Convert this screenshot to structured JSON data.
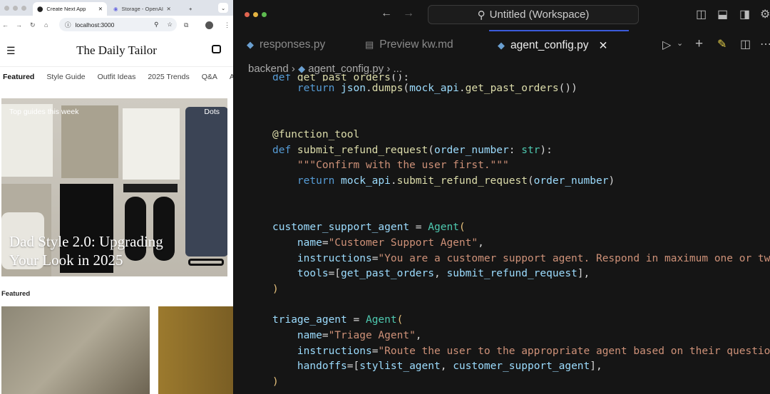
{
  "browser": {
    "tabs": [
      {
        "label": "Create Next App",
        "active": true
      },
      {
        "label": "Storage - OpenAI AI",
        "active": false
      }
    ],
    "url": "localhost:3000",
    "site_title": "The Daily Tailor",
    "categories": [
      "Featured",
      "Style Guide",
      "Outfit Ideas",
      "2025 Trends",
      "Q&A",
      "A"
    ],
    "hero": {
      "label_left": "Top guides this week",
      "label_right": "Dots",
      "title_line1": "Dad Style 2.0: Upgrading",
      "title_line2": "Your Look in 2025"
    },
    "featured_label": "Featured"
  },
  "editor": {
    "search": "Untitled (Workspace)",
    "tabs": [
      {
        "label": "responses.py"
      },
      {
        "label": "Preview kw.md"
      },
      {
        "label": "agent_config.py",
        "active": true
      }
    ],
    "breadcrumb": [
      "backend",
      "agent_config.py",
      "..."
    ],
    "code": [
      [
        [
          "kw",
          "def "
        ],
        [
          "fn",
          "get_past_orders"
        ],
        [
          "pu",
          "():"
        ]
      ],
      [
        [
          "pu",
          "    "
        ],
        [
          "kw",
          "return "
        ],
        [
          "id",
          "json"
        ],
        [
          "pu",
          "."
        ],
        [
          "fn",
          "dumps"
        ],
        [
          "pu",
          "("
        ],
        [
          "id",
          "mock_api"
        ],
        [
          "pu",
          "."
        ],
        [
          "fn",
          "get_past_orders"
        ],
        [
          "pu",
          "())"
        ]
      ],
      [],
      [],
      [
        [
          "dec",
          "@function_tool"
        ]
      ],
      [
        [
          "kw",
          "def "
        ],
        [
          "fn",
          "submit_refund_request"
        ],
        [
          "pu",
          "("
        ],
        [
          "id",
          "order_number"
        ],
        [
          "pu",
          ": "
        ],
        [
          "cl",
          "str"
        ],
        [
          "pu",
          "):"
        ]
      ],
      [
        [
          "pu",
          "    "
        ],
        [
          "st",
          "\"\"\"Confirm with the user first.\"\"\""
        ]
      ],
      [
        [
          "pu",
          "    "
        ],
        [
          "kw",
          "return "
        ],
        [
          "id",
          "mock_api"
        ],
        [
          "pu",
          "."
        ],
        [
          "fn",
          "submit_refund_request"
        ],
        [
          "pu",
          "("
        ],
        [
          "id",
          "order_number"
        ],
        [
          "pu",
          ")"
        ]
      ],
      [],
      [],
      [
        [
          "id",
          "customer_support_agent"
        ],
        [
          "pu",
          " = "
        ],
        [
          "cl",
          "Agent"
        ],
        [
          "br",
          "("
        ]
      ],
      [
        [
          "pu",
          "    "
        ],
        [
          "id",
          "name"
        ],
        [
          "pu",
          "="
        ],
        [
          "st",
          "\"Customer Support Agent\""
        ],
        [
          "pu",
          ","
        ]
      ],
      [
        [
          "pu",
          "    "
        ],
        [
          "id",
          "instructions"
        ],
        [
          "pu",
          "="
        ],
        [
          "st",
          "\"You are a customer support agent. Respond in maximum one or two"
        ]
      ],
      [
        [
          "pu",
          "    "
        ],
        [
          "id",
          "tools"
        ],
        [
          "pu",
          "=["
        ],
        [
          "id",
          "get_past_orders"
        ],
        [
          "pu",
          ", "
        ],
        [
          "id",
          "submit_refund_request"
        ],
        [
          "pu",
          "],"
        ]
      ],
      [
        [
          "br",
          ")"
        ]
      ],
      [],
      [
        [
          "id",
          "triage_agent"
        ],
        [
          "pu",
          " = "
        ],
        [
          "cl",
          "Agent"
        ],
        [
          "br",
          "("
        ]
      ],
      [
        [
          "pu",
          "    "
        ],
        [
          "id",
          "name"
        ],
        [
          "pu",
          "="
        ],
        [
          "st",
          "\"Triage Agent\""
        ],
        [
          "pu",
          ","
        ]
      ],
      [
        [
          "pu",
          "    "
        ],
        [
          "id",
          "instructions"
        ],
        [
          "pu",
          "="
        ],
        [
          "st",
          "\"Route the user to the appropriate agent based on their question"
        ]
      ],
      [
        [
          "pu",
          "    "
        ],
        [
          "id",
          "handoffs"
        ],
        [
          "pu",
          "=["
        ],
        [
          "id",
          "stylist_agent"
        ],
        [
          "pu",
          ", "
        ],
        [
          "id",
          "customer_support_agent"
        ],
        [
          "pu",
          "],"
        ]
      ],
      [
        [
          "br",
          ")"
        ]
      ]
    ]
  }
}
